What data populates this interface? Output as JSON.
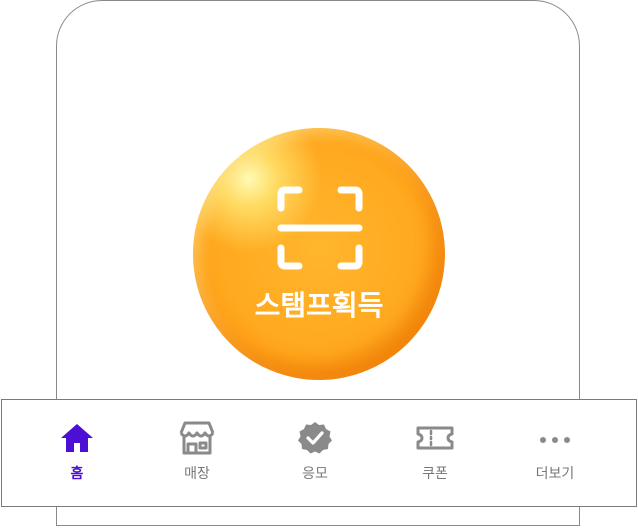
{
  "stamp": {
    "label": "스탬프획득",
    "icon": "scan-frame-icon"
  },
  "tabs": [
    {
      "label": "홈",
      "icon": "home-icon",
      "active": true
    },
    {
      "label": "매장",
      "icon": "store-icon",
      "active": false
    },
    {
      "label": "응모",
      "icon": "verified-badge-icon",
      "active": false
    },
    {
      "label": "쿠폰",
      "icon": "ticket-icon",
      "active": false
    },
    {
      "label": "더보기",
      "icon": "more-dots-icon",
      "active": false
    }
  ],
  "colors": {
    "accent": "#4c10d4",
    "inactive": "#777777",
    "stamp_orange": "#ffa91f"
  }
}
